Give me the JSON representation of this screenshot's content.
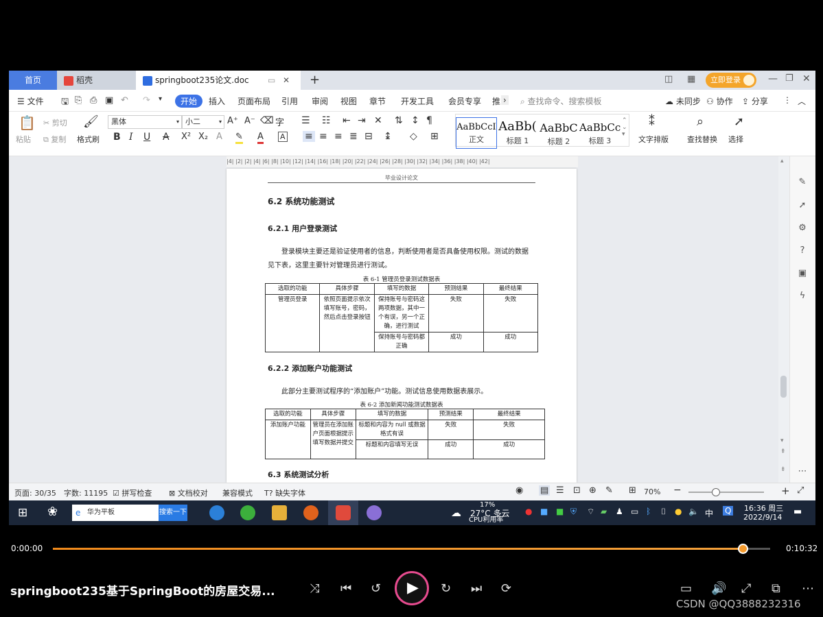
{
  "tabs": {
    "home": "首页",
    "daoke": "稻壳",
    "doc": "springboot235论文.doc",
    "new_tab": "+"
  },
  "titlebar": {
    "login": "立即登录"
  },
  "menu": {
    "file": "文件",
    "items": [
      "开始",
      "插入",
      "页面布局",
      "引用",
      "审阅",
      "视图",
      "章节",
      "开发工具",
      "会员专享",
      "推"
    ],
    "search_placeholder": "查找命令、搜索模板",
    "sync": "未同步",
    "collab": "协作",
    "share": "分享"
  },
  "toolbar": {
    "paste": "粘贴",
    "cut": "剪切",
    "copy": "复制",
    "format_painter": "格式刷",
    "font": "黑体",
    "size": "小二",
    "bold": "B",
    "italic": "I",
    "underline": "U",
    "styles": [
      {
        "sample": "AaBbCcI",
        "name": "正文"
      },
      {
        "sample": "AaBb(",
        "name": "标题 1"
      },
      {
        "sample": "AaBbC",
        "name": "标题 2"
      },
      {
        "sample": "AaBbCc",
        "name": "标题 3"
      }
    ],
    "text_layout": "文字排版",
    "find_replace": "查找替换",
    "select": "选择"
  },
  "ruler": "|4| |2| |2| |4| |6| |8| |10| |12| |14| |16| |18| |20| |22| |24| |26| |28| |30| |32| |34| |36| |38| |40| |42|",
  "document": {
    "header": "毕业设计论文",
    "h_62": "6.2  系统功能测试",
    "h_621": "6.2.1  用户登录测试",
    "p1_line1": "登录模块主要还是验证使用者的信息，判断使用者是否具备使用权限。测试的数据",
    "p1_line2": "见下表，这里主要针对管理员进行测试。",
    "table1_caption": "表 6-1  管理员登录测试数据表",
    "table1": {
      "headers": [
        "选取的功能",
        "具体步骤",
        "填写的数据",
        "预测结果",
        "最终结果"
      ],
      "func": "管理员登录",
      "steps": "依照页面提示依次填写账号，密码，然后点击登录按钮",
      "rows": [
        [
          "保持账号与密码这两项数据，其中一个有误，另一个正确，进行测试",
          "失败",
          "失败"
        ],
        [
          "保持账号与密码都正确",
          "成功",
          "成功"
        ]
      ]
    },
    "h_622": "6.2.2  添加账户功能测试",
    "p2": "此部分主要测试程序的“添加账户”功能。测试信息使用数据表展示。",
    "table2_caption": "表 6-2  添加新闻功能测试数据表",
    "table2": {
      "headers": [
        "选取的功能",
        "具体步骤",
        "填写的数据",
        "预测结果",
        "最终结果"
      ],
      "func": "添加账户功能",
      "steps": "管理员在添加账户页面根据提示填写数据并提交",
      "rows": [
        [
          "标题和内容为 null 或数据格式有误",
          "失败",
          "失败"
        ],
        [
          "标题和内容填写无误",
          "成功",
          "成功"
        ]
      ]
    },
    "h_63": "6.3  系统测试分析"
  },
  "status": {
    "page": "页面: 30/35",
    "words": "字数: 11195",
    "spell": "拼写检查",
    "proof": "文档校对",
    "compat": "兼容模式",
    "missing_font": "缺失字体",
    "zoom": "70%"
  },
  "taskbar": {
    "search_text": "华为平板",
    "search_btn": "搜索一下",
    "weather": "27°C 多云",
    "cpu_pct": "17%",
    "cpu_label": "CPU利用率",
    "ime": "中",
    "time": "16:36 周三",
    "date": "2022/9/14"
  },
  "player": {
    "current": "0:00:00",
    "total": "0:10:32",
    "progress": 0.963,
    "title": "springboot235基于SpringBoot的房屋交易...",
    "watermark": "CSDN @QQ3888232316"
  },
  "colors": {
    "accent": "#3c72e6",
    "progress": "#f59b2e",
    "taskbar": "#1b2638"
  }
}
